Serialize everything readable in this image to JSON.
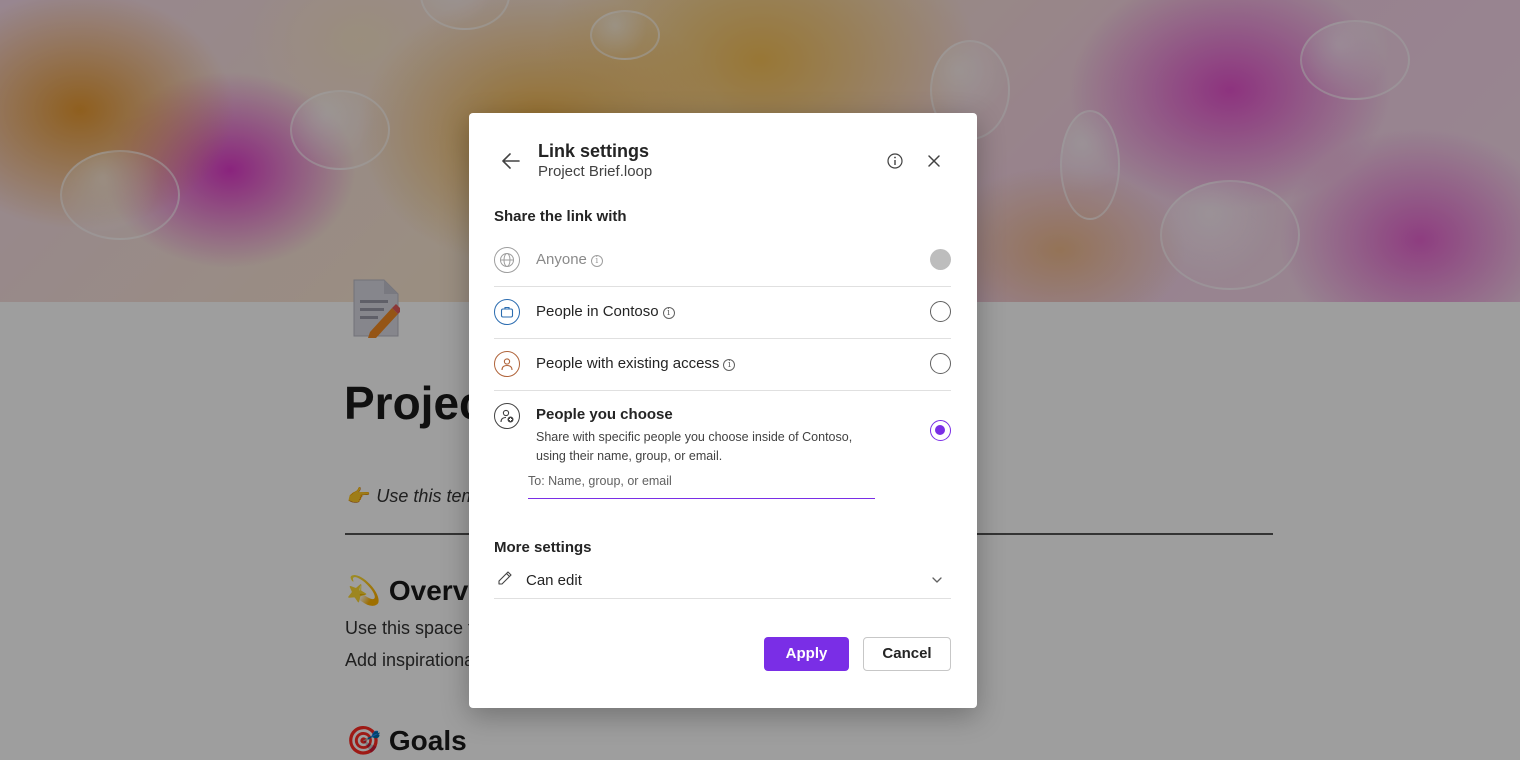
{
  "background_page": {
    "title": "Projec",
    "hint_text": "Use this temp",
    "overview_heading": "Overvie",
    "overview_line1": "Use this space to",
    "overview_line2": "Add inspirationa",
    "goals_heading": "Goals"
  },
  "dialog": {
    "title": "Link settings",
    "subtitle": "Project Brief.loop",
    "share_section_label": "Share the link with",
    "options": [
      {
        "label": "Anyone",
        "icon": "globe-icon",
        "state": "disabled"
      },
      {
        "label": "People in Contoso",
        "icon": "briefcase-icon",
        "state": "unselected"
      },
      {
        "label": "People with existing access",
        "icon": "person-icon",
        "state": "unselected"
      },
      {
        "label": "People you choose",
        "icon": "person-add-icon",
        "state": "selected",
        "description": "Share with specific people you choose inside of Contoso, using their name, group, or email."
      }
    ],
    "to_field_placeholder": "To: Name, group, or email",
    "more_settings_label": "More settings",
    "permission_value": "Can edit",
    "apply_label": "Apply",
    "cancel_label": "Cancel"
  },
  "colors": {
    "accent": "#7a2ee6",
    "overlay": "rgba(0,0,0,0.38)"
  }
}
